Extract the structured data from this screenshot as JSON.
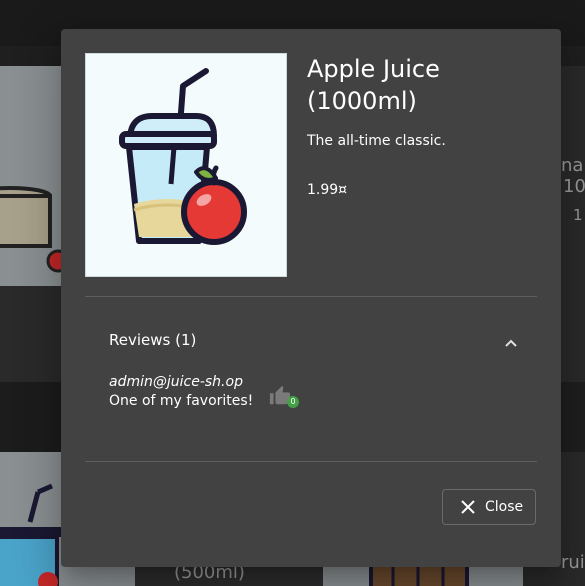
{
  "background": {
    "partial_texts": [
      "na",
      "10",
      "1",
      "(500ml)",
      "ruit"
    ]
  },
  "dialog": {
    "title": "Apple Juice (1000ml)",
    "description": "The all-time classic.",
    "price": "1.99¤",
    "image_alt": "Apple Juice (1000ml)",
    "reviews": {
      "heading": "Reviews (1)",
      "expanded": true,
      "items": [
        {
          "author": "admin@juice-sh.op",
          "message": "One of my favorites!",
          "likes": "0"
        }
      ]
    },
    "close_label": "Close"
  },
  "colors": {
    "dialog_bg": "#424242",
    "like_badge": "#43a047",
    "juice": "#e7d79a",
    "apple": "#e53935"
  },
  "icons": [
    "chevron-up-icon",
    "thumbs-up-icon",
    "close-icon"
  ]
}
